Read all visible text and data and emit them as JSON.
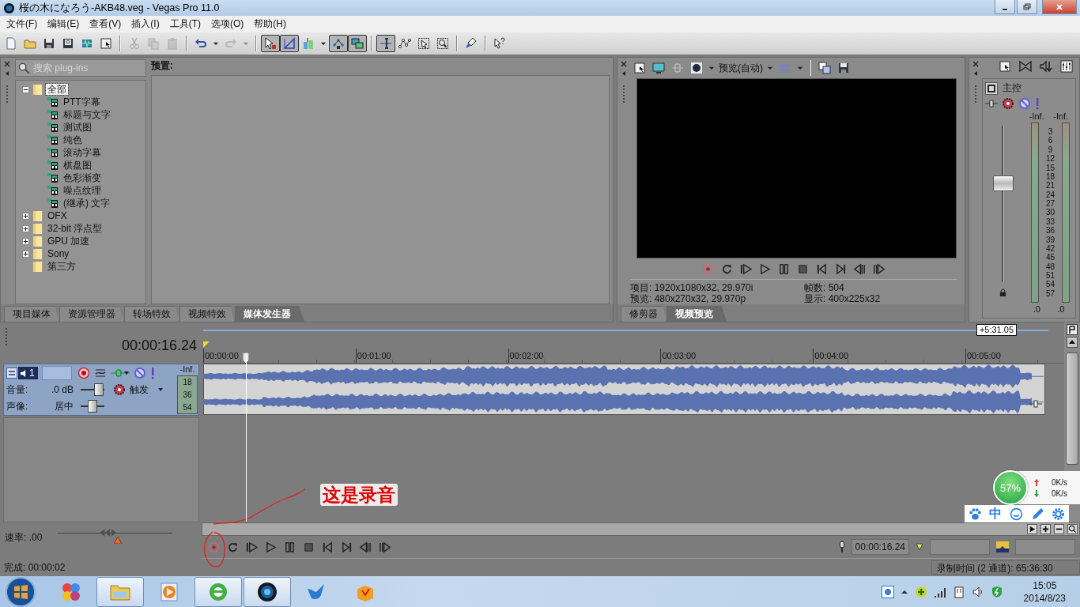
{
  "window": {
    "title": "桜の木になろう-AKB48.veg - Vegas Pro 11.0"
  },
  "menu": [
    "文件(F)",
    "编辑(E)",
    "查看(V)",
    "插入(I)",
    "工具(T)",
    "选项(O)",
    "帮助(H)"
  ],
  "toolbar": [
    [
      {
        "kind": "new",
        "pressed": false,
        "disabled": false
      },
      {
        "kind": "open",
        "pressed": false,
        "disabled": false
      },
      {
        "kind": "save",
        "pressed": false,
        "disabled": false
      },
      {
        "kind": "save-as",
        "pressed": false,
        "disabled": false
      },
      {
        "kind": "render",
        "pressed": false,
        "disabled": false
      },
      {
        "kind": "properties",
        "pressed": false,
        "disabled": false
      }
    ],
    [
      {
        "kind": "cut",
        "pressed": false,
        "disabled": true
      },
      {
        "kind": "copy",
        "pressed": false,
        "disabled": true
      },
      {
        "kind": "paste",
        "pressed": false,
        "disabled": true
      }
    ],
    [
      {
        "kind": "undo",
        "pressed": false,
        "disabled": false
      },
      {
        "kind": "menu",
        "pressed": false,
        "disabled": false
      },
      {
        "kind": "redo",
        "pressed": false,
        "disabled": true
      },
      {
        "kind": "menu",
        "pressed": false,
        "disabled": true
      }
    ],
    [
      {
        "kind": "snap",
        "pressed": true,
        "disabled": false
      },
      {
        "kind": "envelope",
        "pressed": true,
        "disabled": false
      },
      {
        "kind": "tool",
        "pressed": false,
        "disabled": false
      },
      {
        "kind": "menu",
        "pressed": false,
        "disabled": false
      },
      {
        "kind": "lock",
        "pressed": true,
        "disabled": false
      },
      {
        "kind": "ripple",
        "pressed": true,
        "disabled": false
      }
    ],
    [
      {
        "kind": "edit",
        "pressed": true,
        "disabled": false
      },
      {
        "kind": "nodes",
        "pressed": false,
        "disabled": false
      },
      {
        "kind": "select",
        "pressed": false,
        "disabled": false
      },
      {
        "kind": "zoom",
        "pressed": false,
        "disabled": false
      }
    ],
    [
      {
        "kind": "brush",
        "pressed": false,
        "disabled": false
      }
    ],
    [
      {
        "kind": "help",
        "pressed": false,
        "disabled": false
      }
    ]
  ],
  "plugins": {
    "search": {
      "placeholder": "搜索 plug-ins"
    },
    "presets_label": "预置:",
    "tree": [
      {
        "label": "全部",
        "kind": "folder",
        "expanded": true,
        "selected": true,
        "children": [
          {
            "label": "PTT字幕",
            "kind": "plugin",
            "selected": false
          },
          {
            "label": "标题与文字",
            "kind": "plugin",
            "selected": false
          },
          {
            "label": "测试图",
            "kind": "plugin",
            "selected": false
          },
          {
            "label": "纯色",
            "kind": "plugin",
            "selected": false
          },
          {
            "label": "滚动字幕",
            "kind": "plugin",
            "selected": false
          },
          {
            "label": "棋盘图",
            "kind": "plugin",
            "selected": false
          },
          {
            "label": "色彩渐变",
            "kind": "plugin",
            "selected": false
          },
          {
            "label": "噪点纹理",
            "kind": "plugin",
            "selected": false
          },
          {
            "label": "(继承) 文字",
            "kind": "plugin",
            "selected": false
          }
        ]
      },
      {
        "label": "OFX",
        "kind": "folder",
        "expanded": false,
        "selected": false
      },
      {
        "label": "32-bit 浮点型",
        "kind": "folder",
        "expanded": false,
        "selected": false
      },
      {
        "label": "GPU 加速",
        "kind": "folder",
        "expanded": false,
        "selected": false
      },
      {
        "label": "Sony",
        "kind": "folder",
        "expanded": false,
        "selected": false
      },
      {
        "label": "第三方",
        "kind": "folder",
        "selected": false
      }
    ],
    "tabs": [
      {
        "label": "项目媒体",
        "selected": false
      },
      {
        "label": "资源管理器",
        "selected": false
      },
      {
        "label": "转场特效",
        "selected": false
      },
      {
        "label": "视频特效",
        "selected": false
      },
      {
        "label": "媒体发生器",
        "selected": true
      }
    ]
  },
  "preview": {
    "mode": "预览(自动)",
    "info": [
      {
        "label": "项目:",
        "value": "1920x1080x32, 29.970i"
      },
      {
        "label": "帧数:",
        "value": "504"
      },
      {
        "label": "预览:",
        "value": "480x270x32, 29.970p"
      },
      {
        "label": "显示:",
        "value": "400x225x32"
      }
    ],
    "tabs": [
      {
        "label": "修剪器",
        "selected": false
      },
      {
        "label": "视频预览",
        "selected": true
      }
    ]
  },
  "master": {
    "title": "主控",
    "peaks": [
      "-Inf.",
      "-Inf."
    ],
    "scale": [
      "3",
      "6",
      "9",
      "12",
      "15",
      "18",
      "21",
      "24",
      "27",
      "30",
      "33",
      "36",
      "39",
      "42",
      "45",
      "48",
      "51",
      "54",
      "57"
    ],
    "readings": [
      ".0",
      ".0"
    ],
    "level": 0.63
  },
  "timeline": {
    "time": "00:00:16.24",
    "region_end": "+5:31.05",
    "ruler": [
      "00:00:00",
      "00:01:00",
      "00:02:00",
      "00:03:00",
      "00:04:00",
      "00:05:00"
    ],
    "track": {
      "number": "1",
      "volume_label": "音量:",
      "volume": ".0 dB",
      "volume_slider": {
        "level": 0.75
      },
      "pan_label": "声像:",
      "pan": "居中",
      "pan_slider": {
        "level": 0.5
      },
      "fx": "触发",
      "peak": "-Inf.",
      "meter_scale": [
        "18",
        "36",
        "54"
      ]
    },
    "rate_label": "速率: .00",
    "rate_slider": {
      "level": 0.5
    }
  },
  "transport": {
    "time": "00:00:16.24"
  },
  "status": {
    "left": "完成: 00:00:02",
    "right": "录制时间 (2 通道): 65:36:30"
  },
  "annotation": "这是录音",
  "network": {
    "percent": "57%",
    "up": "0K/s",
    "down": "0K/s"
  },
  "ime": {
    "mode": "中"
  },
  "taskbar": {
    "apps": [
      {
        "kind": "colors",
        "open": false
      },
      {
        "kind": "explorer",
        "open": true
      },
      {
        "kind": "player",
        "open": false
      },
      {
        "kind": "browser",
        "open": true
      },
      {
        "kind": "vegas",
        "open": true
      },
      {
        "kind": "bird",
        "open": false
      },
      {
        "kind": "box",
        "open": false
      }
    ],
    "time": "15:05",
    "date": "2014/8/23"
  }
}
